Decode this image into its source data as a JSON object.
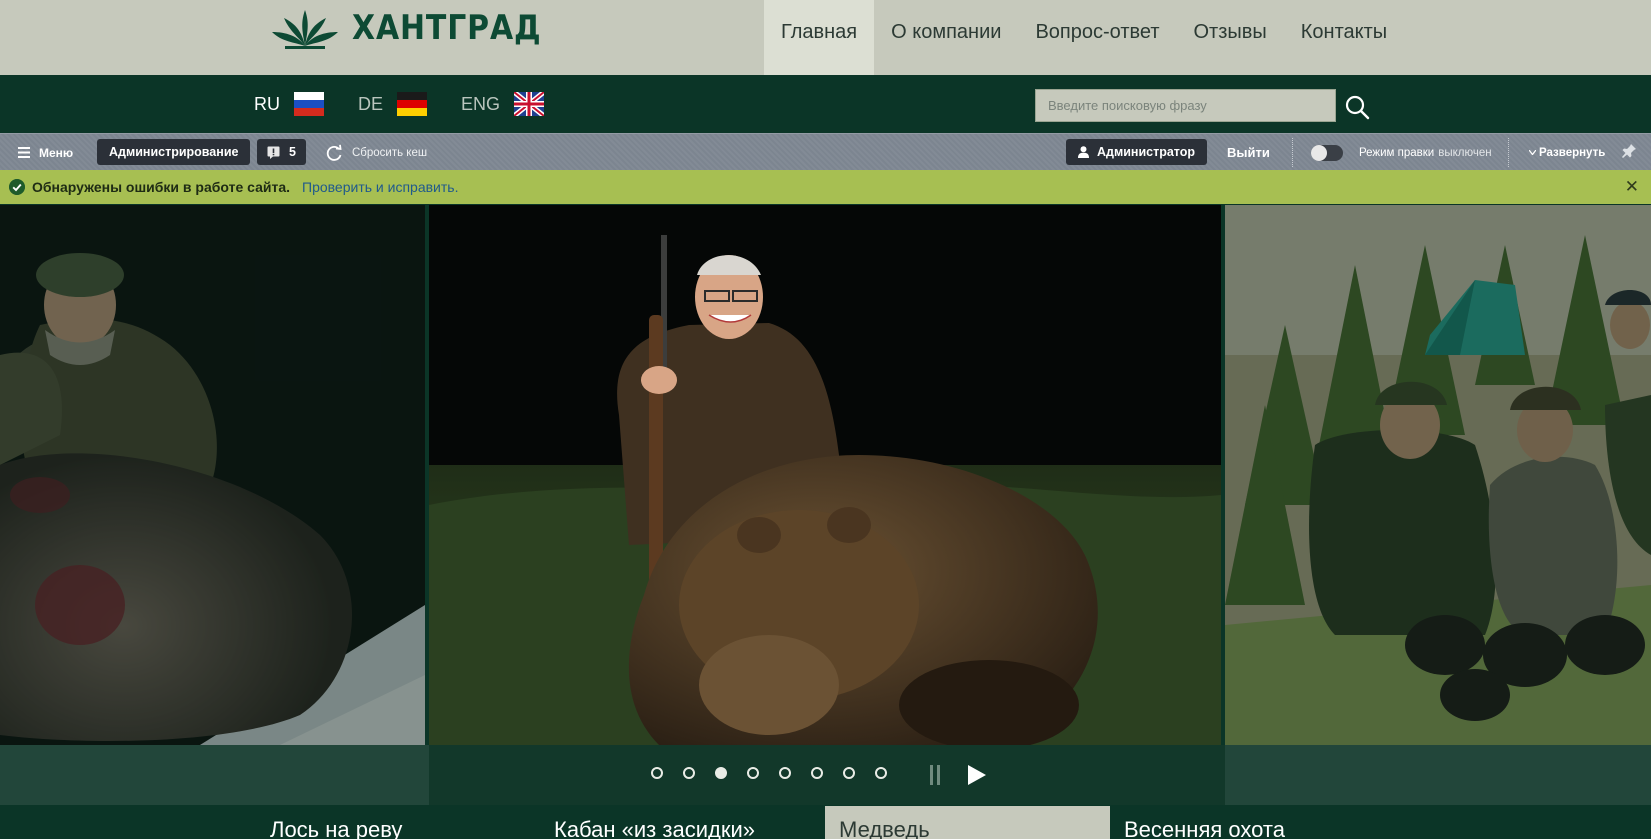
{
  "brand": {
    "name": "ХАНТГРАД"
  },
  "nav": {
    "items": [
      {
        "label": "Главная",
        "active": true
      },
      {
        "label": "О компании"
      },
      {
        "label": "Вопрос-ответ"
      },
      {
        "label": "Отзывы"
      },
      {
        "label": "Контакты"
      }
    ]
  },
  "languages": [
    {
      "code": "RU",
      "flag": "russia-flag-icon",
      "active": true
    },
    {
      "code": "DE",
      "flag": "germany-flag-icon"
    },
    {
      "code": "ENG",
      "flag": "uk-flag-icon"
    }
  ],
  "search": {
    "placeholder": "Введите поисковую фразу",
    "icon": "search-icon"
  },
  "admin_toolbar": {
    "menu_label": "Меню",
    "admin_label": "Администрирование",
    "notifications_count": "5",
    "reset_cache_label": "Сбросить кеш",
    "user_label": "Администратор",
    "logout_label": "Выйти",
    "edit_mode_label": "Режим правки",
    "edit_mode_state": "выключен",
    "expand_label": "Развернуть"
  },
  "notice": {
    "message": "Обнаружены ошибки в работе сайта.",
    "link": "Проверить и исправить.",
    "close": "✕"
  },
  "slider": {
    "dots_total": 8,
    "active_dot": 3,
    "pause_icon": "pause-icon",
    "play_icon": "play-icon"
  },
  "tabs": [
    {
      "label": "Лось на реву"
    },
    {
      "label": "Кабан «из засидки»"
    },
    {
      "label": "Медведь",
      "active": true
    },
    {
      "label": "Весенняя охота"
    }
  ],
  "colors": {
    "header_bg": "#c6c9bc",
    "dark_green": "#0b3527",
    "admin_bar": "#7c8590",
    "notice_bg": "#a7bf52",
    "link": "#205a8c"
  }
}
